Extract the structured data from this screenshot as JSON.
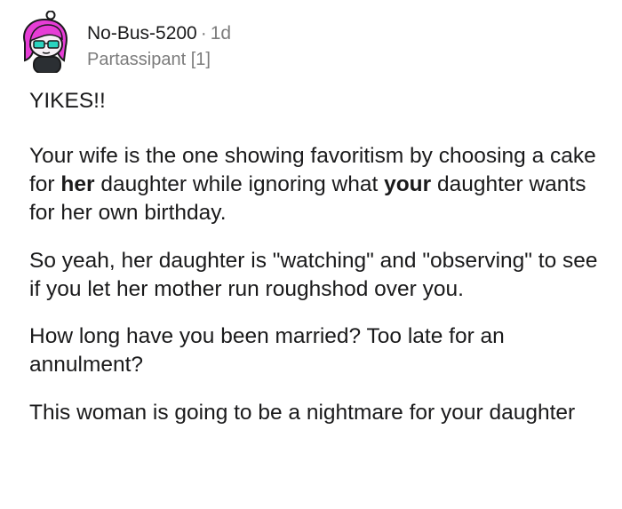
{
  "comment": {
    "username": "No-Bus-5200",
    "separator": "·",
    "age": "1d",
    "flair": "Partassipant [1]",
    "paragraphs": {
      "p1": "YIKES!!",
      "p2": {
        "part1": "Your wife is the one showing favoritism by choosing a cake for ",
        "bold1": "her",
        "part2": " daughter while ignoring what ",
        "bold2": "your",
        "part3": " daughter wants for her own birthday."
      },
      "p3": "So yeah, her daughter is \"watching\" and \"observing\" to see if you let her mother run roughshod over you.",
      "p4": "How long have you been married? Too late for an annulment?",
      "p5": "This woman is going to be a nightmare for your daughter"
    }
  },
  "colors": {
    "text": "#1a1a1b",
    "meta_gray": "#7c7c7c",
    "avatar_hair": "#e63dd6",
    "avatar_glasses": "#2bd4c0"
  },
  "icons": {
    "avatar": "snoo-avatar-pink-hair-glasses"
  }
}
